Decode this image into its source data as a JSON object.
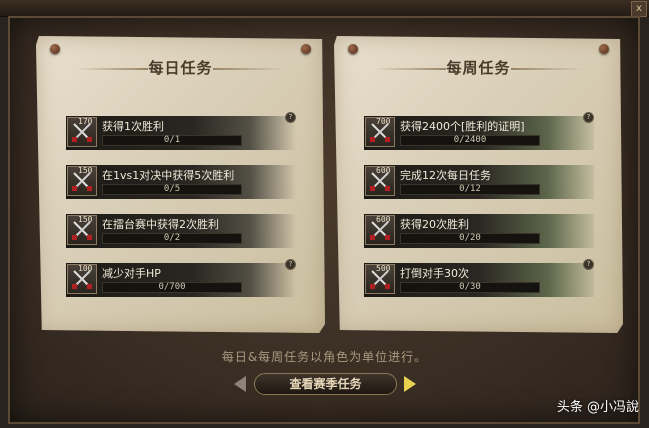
{
  "close_label": "x",
  "daily": {
    "title": "每日任务",
    "tasks": [
      {
        "points": "170",
        "name": "获得1次胜利",
        "progress": "0/1",
        "help": "?"
      },
      {
        "points": "150",
        "name": "在1vs1对决中获得5次胜利",
        "progress": "0/5",
        "help": ""
      },
      {
        "points": "150",
        "name": "在擂台赛中获得2次胜利",
        "progress": "0/2",
        "help": ""
      },
      {
        "points": "100",
        "name": "减少对手HP",
        "progress": "0/700",
        "help": "?"
      }
    ]
  },
  "weekly": {
    "title": "每周任务",
    "tasks": [
      {
        "points": "700",
        "name": "获得2400个[胜利的证明]",
        "progress": "0/2400",
        "help": "?"
      },
      {
        "points": "600",
        "name": "完成12次每日任务",
        "progress": "0/12",
        "help": ""
      },
      {
        "points": "600",
        "name": "获得20次胜利",
        "progress": "0/20",
        "help": ""
      },
      {
        "points": "500",
        "name": "打倒对手30次",
        "progress": "0/30",
        "help": "?"
      }
    ]
  },
  "note": "每日&每周任务以角色为单位进行。",
  "season_button": "查看赛季任务",
  "watermark": "头条 @小冯說",
  "icon_names": [
    "crossed-swords-icon",
    "prev-arrow-icon",
    "next-arrow-icon",
    "help-icon",
    "pin-icon"
  ]
}
